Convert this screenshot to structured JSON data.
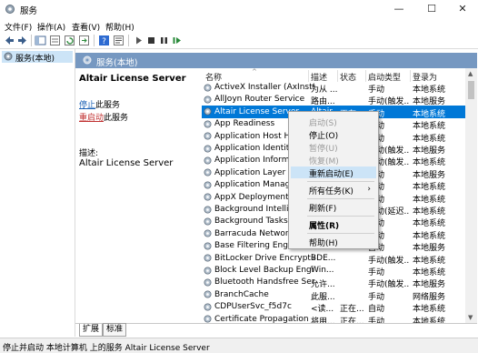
{
  "window": {
    "title": "服务"
  },
  "menubar": {
    "items": [
      "文件(F)",
      "操作(A)",
      "查看(V)",
      "帮助(H)"
    ]
  },
  "tree": {
    "item": "服务(本地)"
  },
  "band": {
    "title": "服务(本地)"
  },
  "detail": {
    "service_name": "Altair License Server",
    "stop_link": "停止",
    "stop_suffix": "此服务",
    "restart_link": "重启动",
    "restart_suffix": "此服务",
    "desc_label": "描述:",
    "desc_text": "Altair License Server"
  },
  "columns": {
    "name": "名称",
    "desc": "描述",
    "status": "状态",
    "start": "启动类型",
    "logon": "登录为"
  },
  "rows": [
    {
      "name": "ActiveX Installer (AxInstSV)",
      "desc": "为从 ...",
      "status": "",
      "start": "手动",
      "logon": "本地系统"
    },
    {
      "name": "AllJoyn Router Service",
      "desc": "路由...",
      "status": "",
      "start": "手动(触发...",
      "logon": "本地服务"
    },
    {
      "name": "Altair License Server",
      "desc": "Altair...",
      "status": "正在...",
      "start": "手动",
      "logon": "本地系统"
    },
    {
      "name": "App Readiness",
      "desc": "",
      "status": "",
      "start": "手动",
      "logon": "本地系统"
    },
    {
      "name": "Application Host Help",
      "desc": "",
      "status": "",
      "start": "自动",
      "logon": "本地系统"
    },
    {
      "name": "Application Identity",
      "desc": "",
      "status": "",
      "start": "手动(触发...",
      "logon": "本地服务"
    },
    {
      "name": "Application Informatio",
      "desc": "",
      "status": "",
      "start": "手动(触发...",
      "logon": "本地系统"
    },
    {
      "name": "Application Layer Gat",
      "desc": "",
      "status": "",
      "start": "手动",
      "logon": "本地服务"
    },
    {
      "name": "Application Managem",
      "desc": "",
      "status": "",
      "start": "手动",
      "logon": "本地系统"
    },
    {
      "name": "AppX Deployment Se",
      "desc": "",
      "status": "",
      "start": "手动",
      "logon": "本地系统"
    },
    {
      "name": "Background Intelliger",
      "desc": "",
      "status": "",
      "start": "自动(延迟...",
      "logon": "本地系统"
    },
    {
      "name": "Background Tasks In",
      "desc": "",
      "status": "",
      "start": "自动",
      "logon": "本地系统"
    },
    {
      "name": "Barracuda Network A",
      "desc": "",
      "status": "",
      "start": "自动",
      "logon": "本地系统"
    },
    {
      "name": "Base Filtering Engine",
      "desc": "",
      "status": "",
      "start": "自动",
      "logon": "本地服务"
    },
    {
      "name": "BitLocker Drive Encryptio...",
      "desc": "BDE...",
      "status": "",
      "start": "手动(触发...",
      "logon": "本地系统"
    },
    {
      "name": "Block Level Backup Engi...",
      "desc": "Win...",
      "status": "",
      "start": "手动",
      "logon": "本地系统"
    },
    {
      "name": "Bluetooth Handsfree Ser...",
      "desc": "允许...",
      "status": "",
      "start": "手动(触发...",
      "logon": "本地服务"
    },
    {
      "name": "BranchCache",
      "desc": "此服...",
      "status": "",
      "start": "手动",
      "logon": "网络服务"
    },
    {
      "name": "CDPUserSvc_f5d7c",
      "desc": "<读...",
      "status": "正在...",
      "start": "自动",
      "logon": "本地系统"
    },
    {
      "name": "Certificate Propagation",
      "desc": "将用...",
      "status": "正在...",
      "start": "手动",
      "logon": "本地系统"
    }
  ],
  "context_menu": {
    "items": [
      {
        "label": "启动(S)",
        "disabled": true
      },
      {
        "label": "停止(O)",
        "disabled": false
      },
      {
        "label": "暂停(U)",
        "disabled": true
      },
      {
        "label": "恢复(M)",
        "disabled": true
      },
      {
        "label": "重新启动(E)",
        "disabled": false,
        "highlight": true
      },
      {
        "label": "所有任务(K)",
        "disabled": false,
        "submenu": true
      },
      {
        "label": "刷新(F)",
        "disabled": false
      },
      {
        "label": "属性(R)",
        "disabled": false,
        "bold": true
      },
      {
        "label": "帮助(H)",
        "disabled": false
      }
    ]
  },
  "tabs": [
    "扩展",
    "标准"
  ],
  "statusbar": {
    "text": "停止并启动 本地计算机 上的服务 Altair License Server"
  },
  "colors": {
    "band": "#7698c1",
    "selection": "#0078d7",
    "menu_highlight": "#cce4f7"
  }
}
